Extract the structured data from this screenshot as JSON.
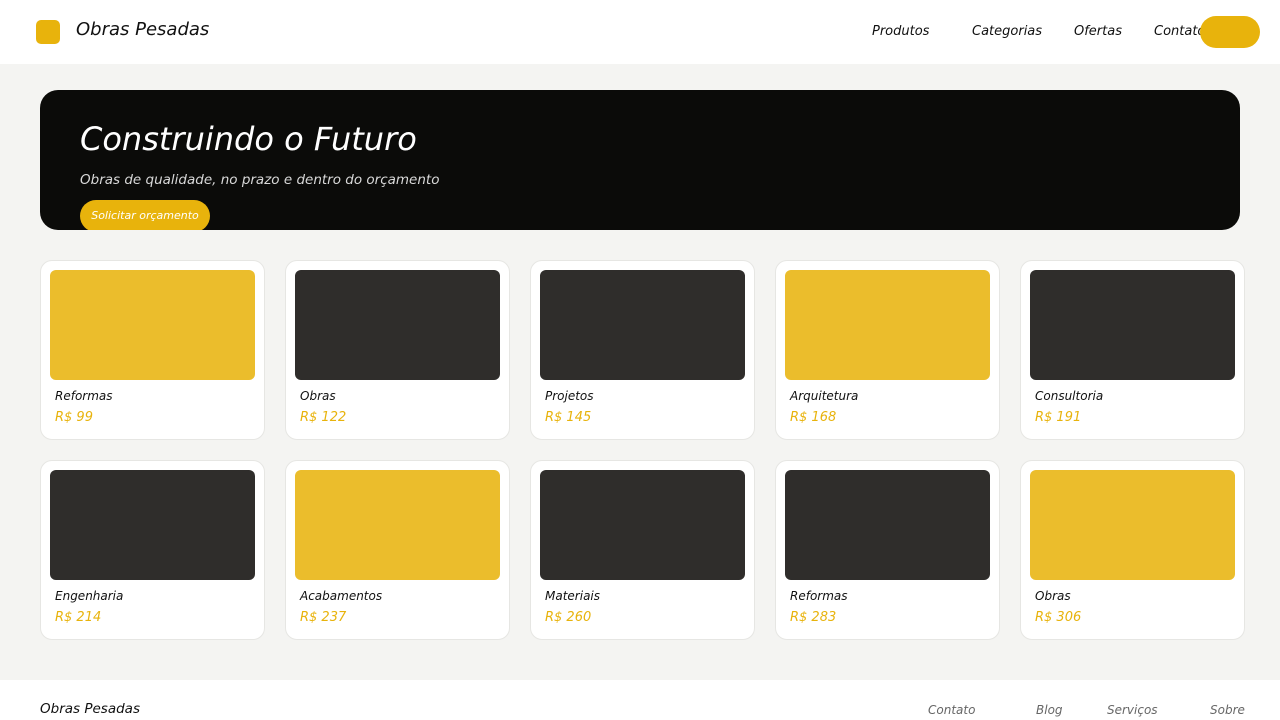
{
  "header": {
    "brand": "Obras Pesadas",
    "nav": [
      "Produtos",
      "Categorias",
      "Ofertas",
      "Contato"
    ],
    "cta_label": ""
  },
  "hero": {
    "title": "Construindo o Futuro",
    "subtitle": "Obras de qualidade, no prazo e dentro do orçamento",
    "cta": "Solicitar orçamento"
  },
  "products": [
    {
      "name": "Reformas",
      "price": "R$ 99",
      "thumb_color": "#ebbd2c"
    },
    {
      "name": "Obras",
      "price": "R$ 122",
      "thumb_color": "#2f2d2b"
    },
    {
      "name": "Projetos",
      "price": "R$ 145",
      "thumb_color": "#2f2d2b"
    },
    {
      "name": "Arquitetura",
      "price": "R$ 168",
      "thumb_color": "#ebbd2c"
    },
    {
      "name": "Consultoria",
      "price": "R$ 191",
      "thumb_color": "#2f2d2b"
    },
    {
      "name": "Engenharia",
      "price": "R$ 214",
      "thumb_color": "#2f2d2b"
    },
    {
      "name": "Acabamentos",
      "price": "R$ 237",
      "thumb_color": "#ebbd2c"
    },
    {
      "name": "Materiais",
      "price": "R$ 260",
      "thumb_color": "#2f2d2b"
    },
    {
      "name": "Reformas",
      "price": "R$ 283",
      "thumb_color": "#2f2d2b"
    },
    {
      "name": "Obras",
      "price": "R$ 306",
      "thumb_color": "#ebbd2c"
    }
  ],
  "footer": {
    "brand": "Obras Pesadas",
    "links": [
      "Contato",
      "Blog",
      "Serviços",
      "Sobre"
    ]
  },
  "colors": {
    "accent": "#e8b30c",
    "hero_bg": "#0b0b09",
    "page_bg": "#f4f4f2"
  }
}
